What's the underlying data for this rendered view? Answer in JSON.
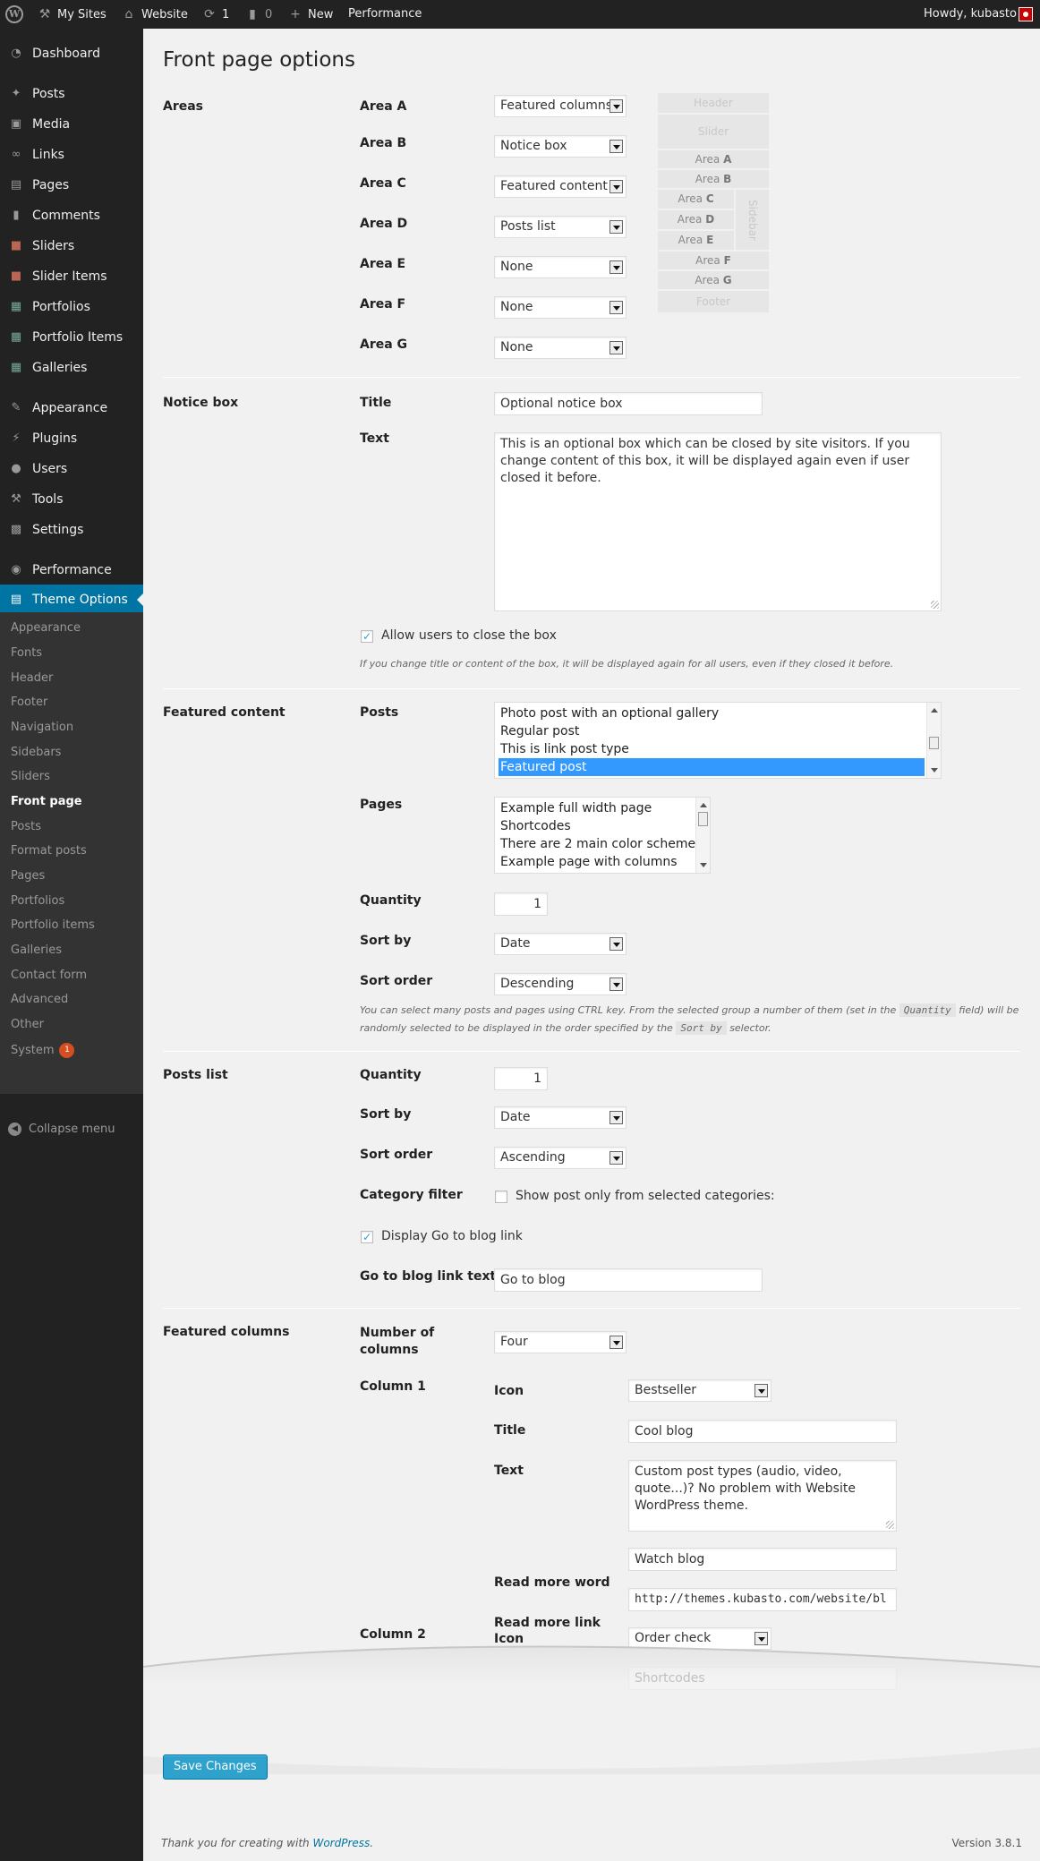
{
  "admin_bar": {
    "my_sites": "My Sites",
    "site_name": "Website",
    "updates_count": "1",
    "comments_count": "0",
    "new_label": "New",
    "performance": "Performance",
    "howdy": "Howdy, kubasto"
  },
  "sidebar": {
    "items": [
      {
        "label": "Dashboard",
        "icon": "dashboard-icon"
      },
      {
        "label": "Posts",
        "icon": "pin-icon"
      },
      {
        "label": "Media",
        "icon": "media-icon"
      },
      {
        "label": "Links",
        "icon": "link-icon"
      },
      {
        "label": "Pages",
        "icon": "page-icon"
      },
      {
        "label": "Comments",
        "icon": "comment-icon"
      },
      {
        "label": "Sliders",
        "icon": "slider-icon"
      },
      {
        "label": "Slider Items",
        "icon": "slider-item-icon"
      },
      {
        "label": "Portfolios",
        "icon": "portfolio-icon"
      },
      {
        "label": "Portfolio Items",
        "icon": "portfolio-item-icon"
      },
      {
        "label": "Galleries",
        "icon": "gallery-icon"
      },
      {
        "label": "Appearance",
        "icon": "brush-icon"
      },
      {
        "label": "Plugins",
        "icon": "plug-icon"
      },
      {
        "label": "Users",
        "icon": "user-icon"
      },
      {
        "label": "Tools",
        "icon": "wrench-icon"
      },
      {
        "label": "Settings",
        "icon": "settings-icon"
      },
      {
        "label": "Performance",
        "icon": "performance-icon"
      },
      {
        "label": "Theme Options",
        "icon": "theme-options-icon"
      }
    ],
    "submenu": [
      "Appearance",
      "Fonts",
      "Header",
      "Footer",
      "Navigation",
      "Sidebars",
      "Sliders",
      "Front page",
      "Posts",
      "Format posts",
      "Pages",
      "Portfolios",
      "Portfolio items",
      "Galleries",
      "Contact form",
      "Advanced",
      "Other",
      "System"
    ],
    "system_badge": "1",
    "collapse": "Collapse menu"
  },
  "page": {
    "title": "Front page options"
  },
  "areas": {
    "section": "Areas",
    "rows": [
      {
        "label": "Area A",
        "value": "Featured columns"
      },
      {
        "label": "Area B",
        "value": "Notice box"
      },
      {
        "label": "Area C",
        "value": "Featured content"
      },
      {
        "label": "Area D",
        "value": "Posts list"
      },
      {
        "label": "Area E",
        "value": "None"
      },
      {
        "label": "Area F",
        "value": "None"
      },
      {
        "label": "Area G",
        "value": "None"
      }
    ],
    "diagram": {
      "header": "Header",
      "slider": "Slider",
      "area_word": "Area",
      "letters": [
        "A",
        "B",
        "C",
        "D",
        "E",
        "F",
        "G"
      ],
      "sidebar": "Sidebar",
      "footer": "Footer"
    }
  },
  "notice_box": {
    "section": "Notice box",
    "title_label": "Title",
    "title_value": "Optional notice box",
    "text_label": "Text",
    "text_value": "This is an optional box which can be closed by site visitors. If you change content of this box, it will be displayed again even if user closed it before.",
    "allow_close_label": "Allow users to close the box",
    "allow_close_checked": true,
    "note": "If you change title or content of the box, it will be displayed again for all users, even if they closed it before."
  },
  "featured_content": {
    "section": "Featured content",
    "posts_label": "Posts",
    "posts_options": [
      "Photo post with an optional gallery",
      "Regular post",
      "This is link post type",
      "Featured post"
    ],
    "posts_selected": "Featured post",
    "pages_label": "Pages",
    "pages_options": [
      "Example full width page",
      "Shortcodes",
      "There are 2 main color schemes:",
      "Example page with columns"
    ],
    "quantity_label": "Quantity",
    "quantity": "1",
    "sort_by_label": "Sort by",
    "sort_by": "Date",
    "sort_order_label": "Sort order",
    "sort_order": "Descending",
    "note_1": "You can select many posts and pages using CTRL key. From the selected group a number of them (set in the",
    "note_code_1": "Quantity",
    "note_2": "field) will be",
    "note_3": "randomly selected to be displayed in the order specified by the",
    "note_code_2": "Sort by",
    "note_4": "selector."
  },
  "posts_list": {
    "section": "Posts list",
    "quantity_label": "Quantity",
    "quantity": "1",
    "sort_by_label": "Sort by",
    "sort_by": "Date",
    "sort_order_label": "Sort order",
    "sort_order": "Ascending",
    "category_label": "Category filter",
    "category_checkbox_label": "Show post only from selected categories:",
    "category_checked": false,
    "blog_link_label": "Display Go to blog link",
    "blog_link_checked": true,
    "blog_text_label": "Go to blog link text",
    "blog_text_value": "Go to blog"
  },
  "featured_columns": {
    "section": "Featured columns",
    "number_label": "Number of columns",
    "number_value": "Four",
    "column1": {
      "label": "Column 1",
      "icon_label": "Icon",
      "icon_value": "Bestseller",
      "title_label": "Title",
      "title_value": "Cool blog",
      "text_label": "Text",
      "text_value": "Custom post types (audio, video, quote...)? No problem with Website WordPress theme.",
      "read_more_word_label": "Read more word",
      "read_more_word_value": "Watch blog",
      "read_more_link_label": "Read more link",
      "read_more_link_value": "http://themes.kubasto.com/website/bl"
    },
    "column2": {
      "label": "Column 2",
      "icon_label": "Icon",
      "icon_value": "Order check",
      "title_value": "Shortcodes"
    }
  },
  "save_button": "Save Changes",
  "footer": {
    "thanks_prefix": "Thank you for creating with",
    "wordpress_link": "WordPress",
    "thanks_suffix": ".",
    "version": "Version 3.8.1"
  }
}
